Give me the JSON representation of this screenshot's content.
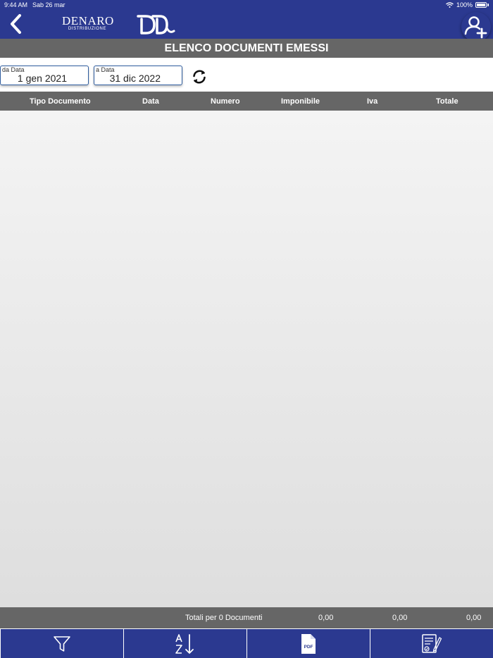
{
  "status_bar": {
    "time": "9:44 AM",
    "date": "Sab 26 mar",
    "battery": "100%"
  },
  "header": {
    "brand": "DENARO",
    "brand_sub": "DISTRIBUZIONE",
    "logo_mark": "DD"
  },
  "title": "ELENCO DOCUMENTI EMESSI",
  "filters": {
    "from": {
      "label": "da Data",
      "value": "1 gen 2021"
    },
    "to": {
      "label": "a Data",
      "value": "31 dic 2022"
    }
  },
  "table": {
    "columns": [
      "Tipo Documento",
      "Data",
      "Numero",
      "Imponibile",
      "Iva",
      "Totale"
    ],
    "rows": []
  },
  "totals": {
    "label": "Totali per 0 Documenti",
    "imponibile": "0,00",
    "iva": "0,00",
    "totale": "0,00"
  },
  "toolbar": {
    "buttons": [
      "filter-icon",
      "sort-az-icon",
      "pdf-icon",
      "signed-document-icon"
    ]
  },
  "colors": {
    "primary": "#2b3990",
    "bar_gray": "#666666",
    "date_border": "#2e5c9e"
  }
}
